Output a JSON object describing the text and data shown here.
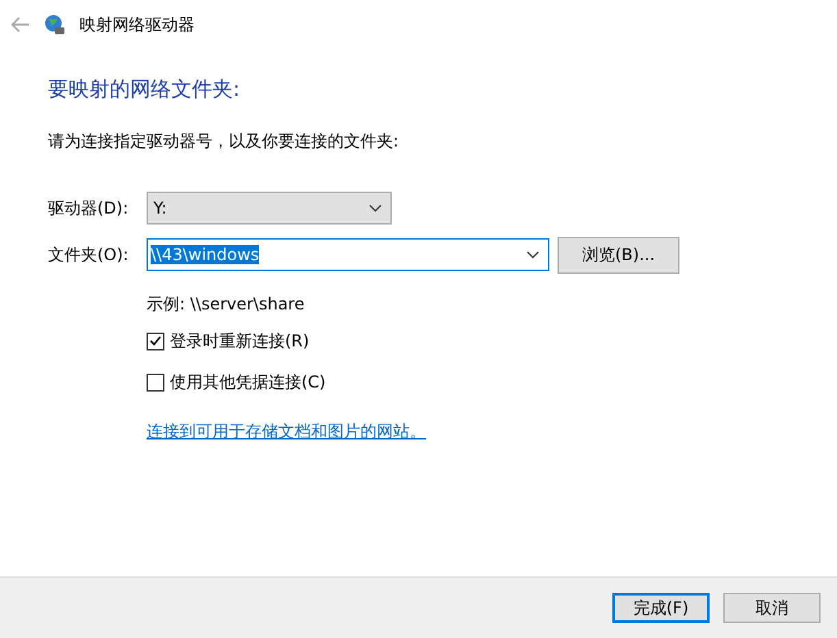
{
  "window": {
    "title": "映射网络驱动器"
  },
  "heading": "要映射的网络文件夹:",
  "instruction": "请为连接指定驱动器号，以及你要连接的文件夹:",
  "drive": {
    "label": "驱动器(D):",
    "value": "Y:"
  },
  "folder": {
    "label": "文件夹(O):",
    "value": "\\\\43\\windows",
    "selected": true
  },
  "browse_button": "浏览(B)...",
  "example": "示例: \\\\server\\share",
  "options": [
    {
      "label": "登录时重新连接(R)",
      "checked": true
    },
    {
      "label": "使用其他凭据连接(C)",
      "checked": false
    }
  ],
  "link": "连接到可用于存储文档和图片的网站。",
  "buttons": [
    {
      "label": "完成(F)",
      "default": true
    },
    {
      "label": "取消",
      "default": false
    }
  ]
}
